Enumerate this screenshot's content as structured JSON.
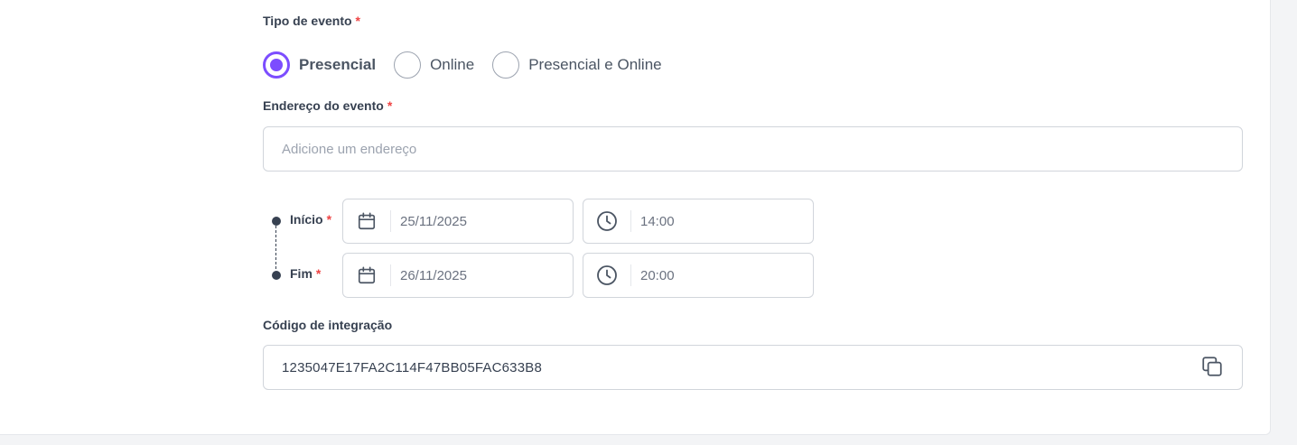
{
  "event_type": {
    "label": "Tipo de evento",
    "required_mark": "*",
    "options": [
      {
        "label": "Presencial",
        "checked": true
      },
      {
        "label": "Online",
        "checked": false
      },
      {
        "label": "Presencial e Online",
        "checked": false
      }
    ]
  },
  "address": {
    "label": "Endereço do evento",
    "required_mark": "*",
    "placeholder": "Adicione um endereço",
    "value": ""
  },
  "schedule": {
    "start": {
      "label": "Início",
      "required_mark": "*",
      "date": "25/11/2025",
      "time": "14:00"
    },
    "end": {
      "label": "Fim",
      "required_mark": "*",
      "date": "26/11/2025",
      "time": "20:00"
    }
  },
  "integration": {
    "label": "Código de integração",
    "value": "1235047E17FA2C114F47BB05FAC633B8"
  },
  "colors": {
    "accent": "#7c4dff",
    "required": "#ef4444",
    "border": "#d1d5db",
    "text": "#374151"
  },
  "icons": {
    "date": "calendar-icon",
    "time": "clock-icon",
    "copy": "copy-icon"
  }
}
